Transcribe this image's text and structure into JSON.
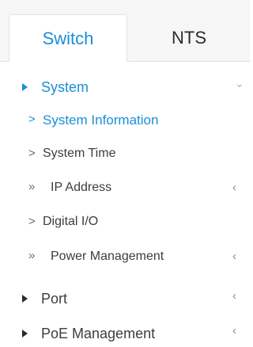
{
  "colors": {
    "accent": "#1a8fd6",
    "text": "#3d3d3d",
    "muted": "#8a8a8a",
    "triangle": "#2b2b2b",
    "tab_bg": "#f6f6f6"
  },
  "tabs": [
    {
      "label": "Switch",
      "active": true
    },
    {
      "label": "NTS",
      "active": false
    }
  ],
  "menu": {
    "system": {
      "label": "System",
      "expanded": true,
      "expand_icon": "chevron-down-icon",
      "children": [
        {
          "label": "System Information",
          "marker": ">",
          "active": true,
          "has_children": false
        },
        {
          "label": "System Time",
          "marker": ">",
          "active": false,
          "has_children": false
        },
        {
          "label": "IP Address",
          "marker": "»",
          "active": false,
          "has_children": true
        },
        {
          "label": "Digital I/O",
          "marker": ">",
          "active": false,
          "has_children": false
        },
        {
          "label": "Power Management",
          "marker": "»",
          "active": false,
          "has_children": true
        }
      ]
    },
    "port": {
      "label": "Port",
      "expanded": false,
      "expand_icon": "chevron-left-icon"
    },
    "poe": {
      "label": "PoE Management",
      "expanded": false,
      "expand_icon": "chevron-left-icon"
    }
  }
}
